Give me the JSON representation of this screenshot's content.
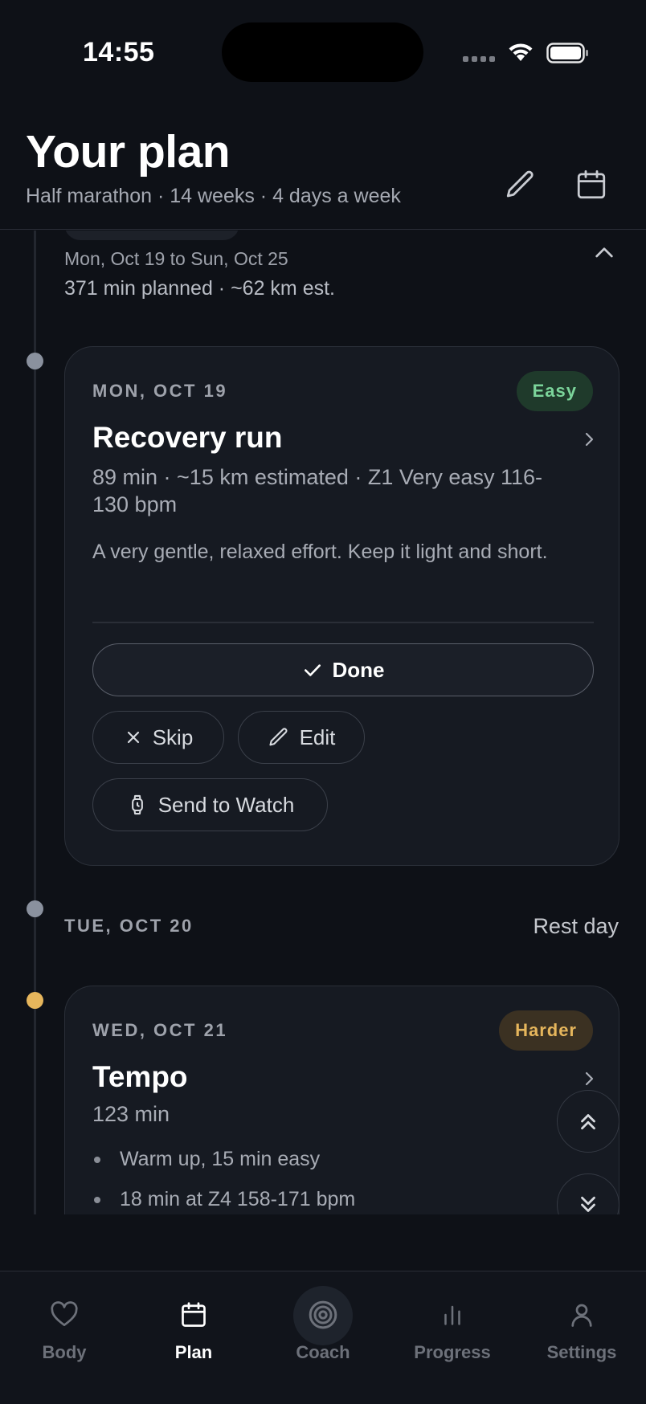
{
  "status_bar": {
    "time": "14:55"
  },
  "header": {
    "title": "Your plan",
    "subtitle": "Half marathon · 14 weeks · 4 days a week",
    "edit_icon": "pencil-icon",
    "calendar_icon": "calendar-icon"
  },
  "week": {
    "range": "Mon, Oct 19 to Sun, Oct 25",
    "summary": "371 min planned · ~62 km est."
  },
  "days": [
    {
      "date": "MON, OCT 19",
      "badge": "Easy",
      "title": "Recovery run",
      "meta": "89 min · ~15 km estimated · Z1 Very easy 116-130 bpm",
      "description": "A very gentle, relaxed effort. Keep it light and short.",
      "actions": {
        "done": "Done",
        "skip": "Skip",
        "edit": "Edit",
        "send": "Send to Watch"
      }
    },
    {
      "date": "TUE, OCT 20",
      "rest_label": "Rest day"
    },
    {
      "date": "WED, OCT 21",
      "badge": "Harder",
      "title": "Tempo",
      "meta": "123 min",
      "steps": [
        "Warm up, 15 min easy",
        "18 min at Z4 158-171 bpm"
      ]
    }
  ],
  "tabs": [
    {
      "label": "Body",
      "icon": "heart-icon"
    },
    {
      "label": "Plan",
      "icon": "calendar-icon"
    },
    {
      "label": "Coach",
      "icon": "target-icon"
    },
    {
      "label": "Progress",
      "icon": "bar-chart-icon"
    },
    {
      "label": "Settings",
      "icon": "person-icon"
    }
  ],
  "active_tab": "Plan",
  "colors": {
    "background": "#0e1117",
    "card": "#161a22",
    "easy": "#7bd49a",
    "harder": "#e6b65c"
  }
}
